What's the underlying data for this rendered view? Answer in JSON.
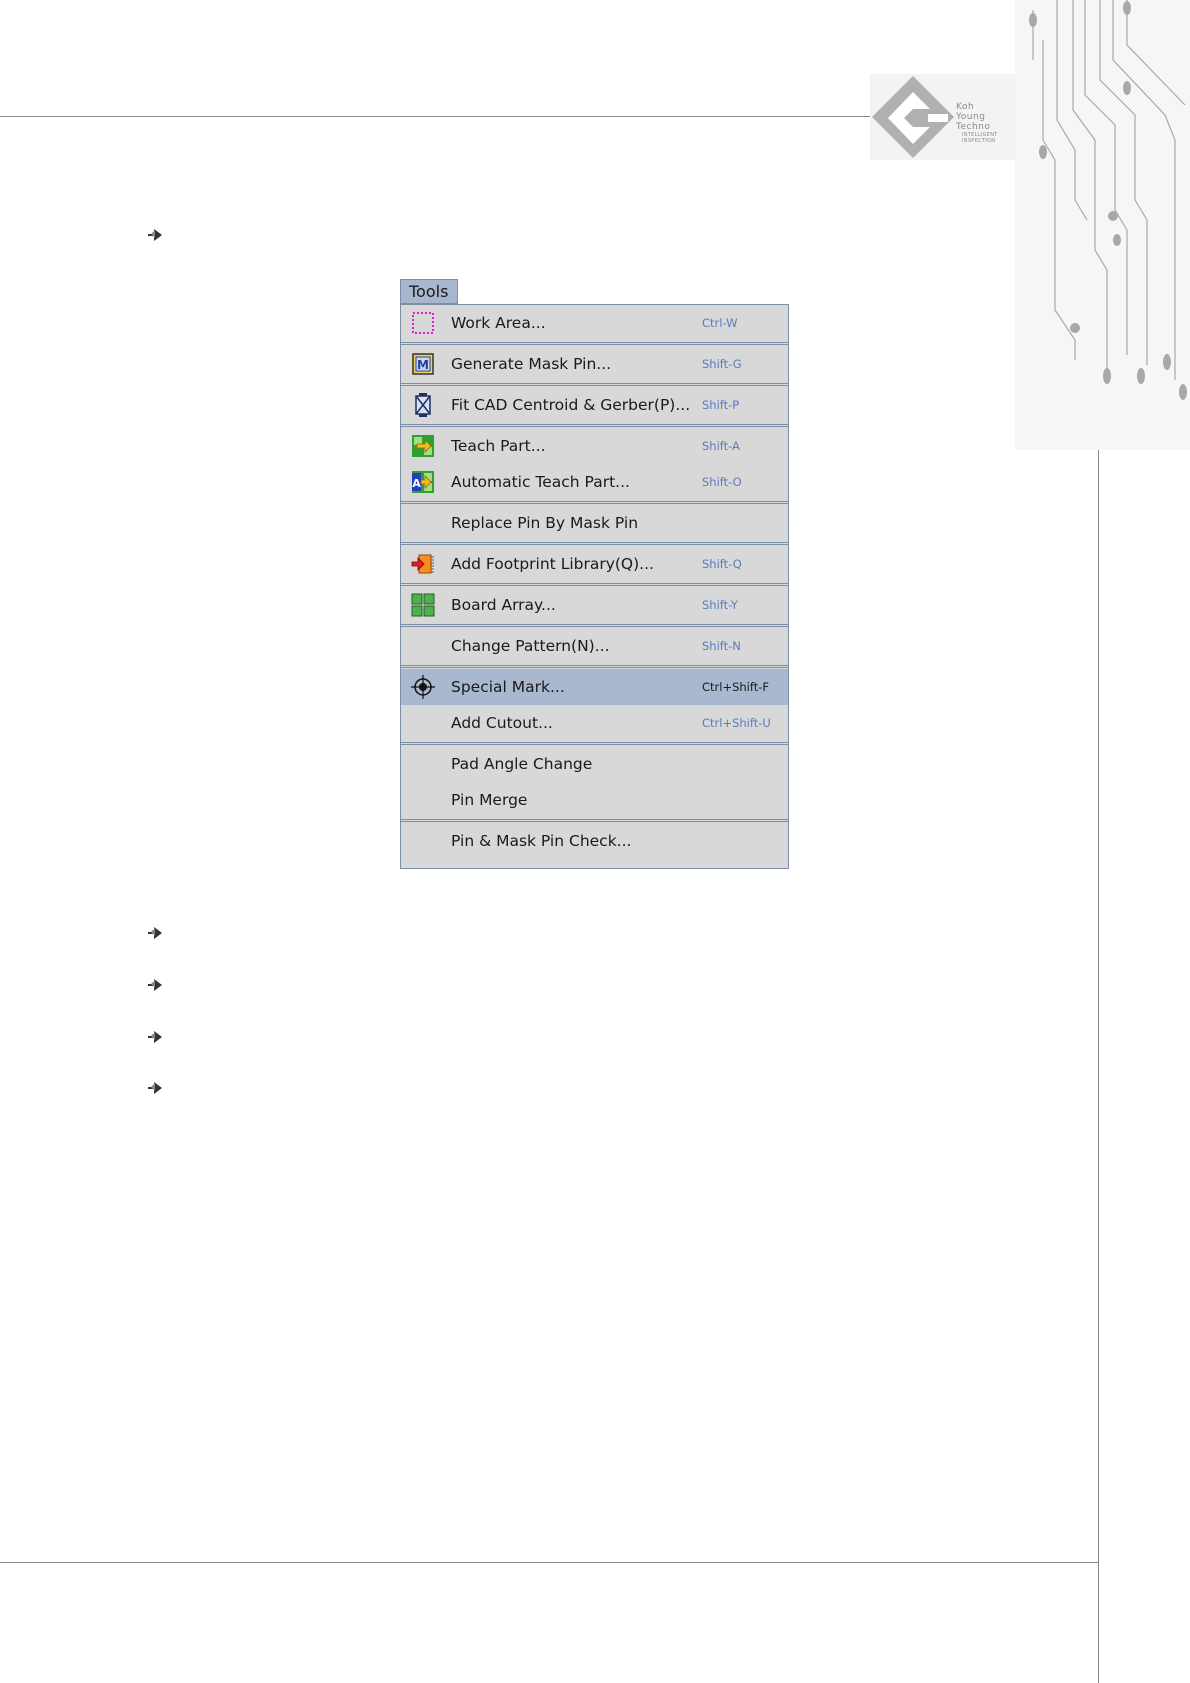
{
  "logo": {
    "line1": "Koh",
    "line2": "Young",
    "line3": "Techno",
    "tag1": "INTELLIGENT",
    "tag2": "INSPECTION"
  },
  "menu": {
    "title": "Tools",
    "items": [
      {
        "label": "Work Area...",
        "shortcut": "Ctrl-W",
        "icon": "work-area-icon"
      },
      {
        "label": "Generate Mask Pin...",
        "shortcut": "Shift-G",
        "icon": "mask-pin-icon"
      },
      {
        "label": "Fit CAD Centroid & Gerber(P)...",
        "shortcut": "Shift-P",
        "icon": "fit-cad-icon"
      },
      {
        "label": "Teach Part...",
        "shortcut": "Shift-A",
        "icon": "teach-part-icon"
      },
      {
        "label": "Automatic Teach Part...",
        "shortcut": "Shift-O",
        "icon": "auto-teach-icon"
      },
      {
        "label": "Replace Pin By Mask Pin",
        "shortcut": "",
        "icon": ""
      },
      {
        "label": "Add Footprint Library(Q)...",
        "shortcut": "Shift-Q",
        "icon": "footprint-library-icon"
      },
      {
        "label": "Board Array...",
        "shortcut": "Shift-Y",
        "icon": "board-array-icon"
      },
      {
        "label": "Change Pattern(N)...",
        "shortcut": "Shift-N",
        "icon": ""
      },
      {
        "label": "Special Mark...",
        "shortcut": "Ctrl+Shift-F",
        "icon": "crosshair-icon"
      },
      {
        "label": "Add Cutout...",
        "shortcut": "Ctrl+Shift-U",
        "icon": ""
      },
      {
        "label": "Pad Angle Change",
        "shortcut": "",
        "icon": ""
      },
      {
        "label": "Pin Merge",
        "shortcut": "",
        "icon": ""
      },
      {
        "label": "Pin & Mask Pin Check...",
        "shortcut": "",
        "icon": ""
      }
    ]
  }
}
